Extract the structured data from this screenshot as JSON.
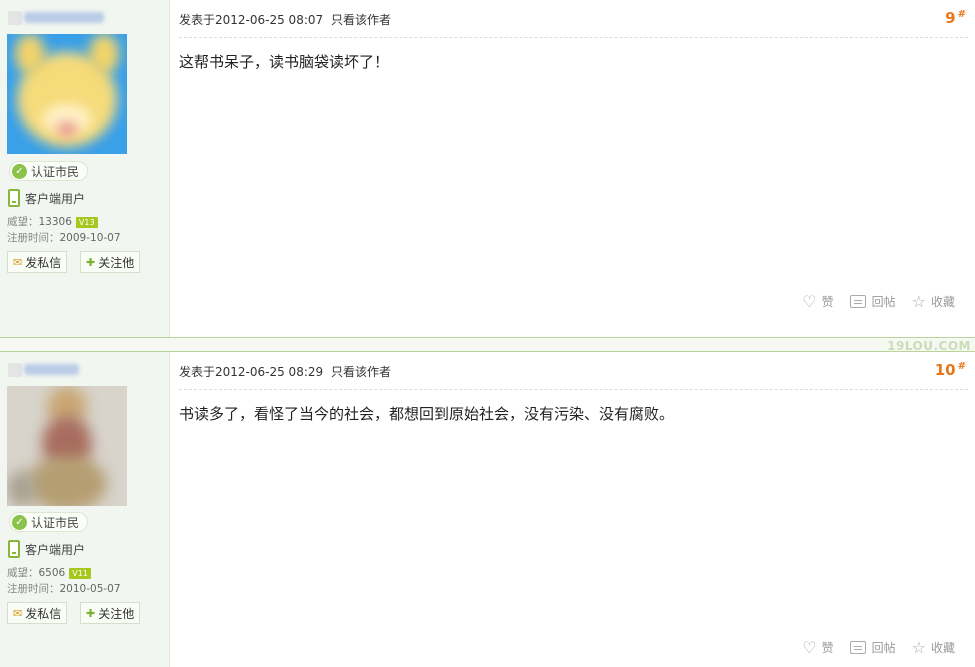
{
  "posts": [
    {
      "author": {
        "badge": "认证市民",
        "client": "客户端用户",
        "prestige_label": "威望：",
        "prestige": "13306",
        "level": "V13",
        "register_label": "注册时间：",
        "register_date": "2009-10-07",
        "btn_message": "发私信",
        "btn_follow": "关注他"
      },
      "meta": {
        "posted": "发表于2012-06-25 08:07",
        "only_author": "只看该作者"
      },
      "floor": "9",
      "floor_mark": "#",
      "text": "这帮书呆子，读书脑袋读坏了！",
      "actions": {
        "like": "赞",
        "reply": "回帖",
        "collect": "收藏"
      }
    },
    {
      "author": {
        "badge": "认证市民",
        "client": "客户端用户",
        "prestige_label": "威望：",
        "prestige": "6506",
        "level": "V11",
        "register_label": "注册时间：",
        "register_date": "2010-05-07",
        "btn_message": "发私信",
        "btn_follow": "关注他"
      },
      "meta": {
        "posted": "发表于2012-06-25 08:29",
        "only_author": "只看该作者"
      },
      "floor": "10",
      "floor_mark": "#",
      "text": "书读多了，看怪了当今的社会，都想回到原始社会，没有污染、没有腐败。",
      "actions": {
        "like": "赞",
        "reply": "回帖",
        "collect": "收藏"
      }
    }
  ],
  "watermark": "19LOU.COM",
  "colors": {
    "floor": "#e8771b",
    "sidebar": "#f1f6f0",
    "accent_green": "#8bc34a"
  }
}
